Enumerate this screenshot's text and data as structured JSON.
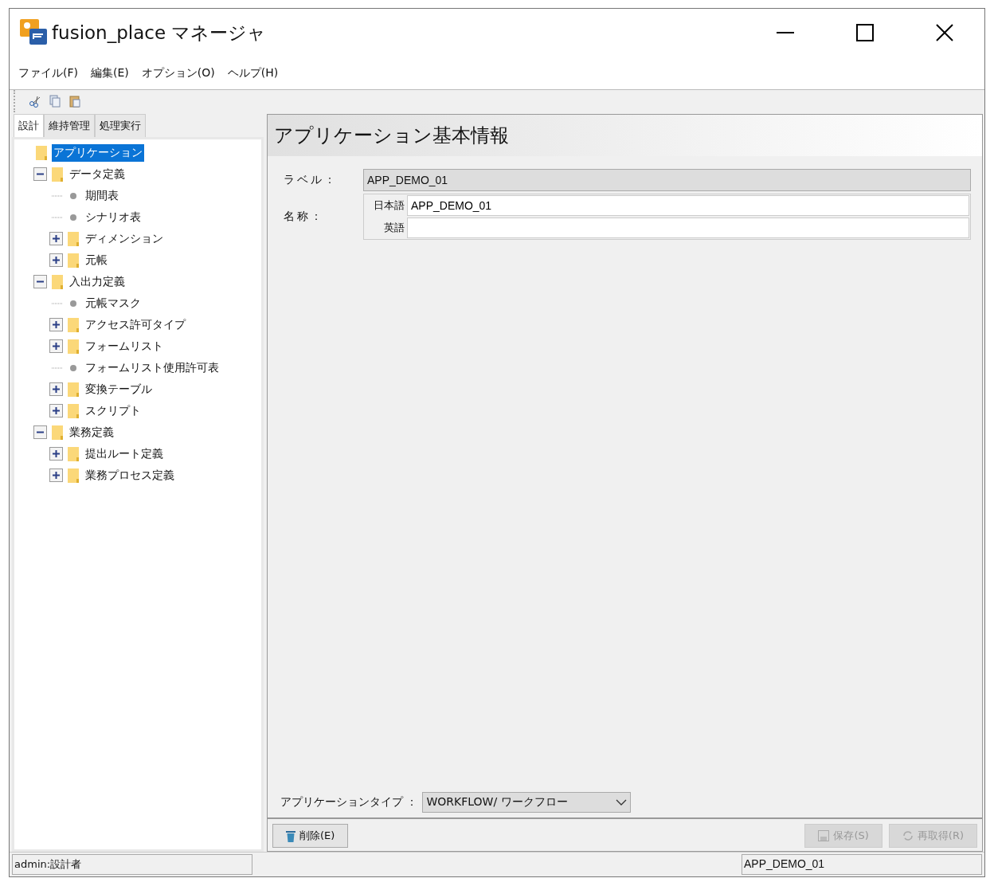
{
  "window": {
    "title": "fusion_place マネージャ"
  },
  "menu": [
    "ファイル(F)",
    "編集(E)",
    "オプション(O)",
    "ヘルプ(H)"
  ],
  "left_tabs": [
    {
      "label": "設計",
      "selected": true
    },
    {
      "label": "維持管理",
      "selected": false
    },
    {
      "label": "処理実行",
      "selected": false
    }
  ],
  "tree": [
    {
      "label": "アプリケーション",
      "kind": "folder",
      "selected": true,
      "children": [
        {
          "label": "データ定義",
          "kind": "folder",
          "expanded": true,
          "selected": false,
          "children": [
            {
              "label": "期間表",
              "kind": "leaf",
              "selected": false
            },
            {
              "label": "シナリオ表",
              "kind": "leaf",
              "selected": false
            },
            {
              "label": "ディメンション",
              "kind": "folder",
              "expanded": false,
              "selected": false
            },
            {
              "label": "元帳",
              "kind": "folder",
              "expanded": false,
              "selected": false
            }
          ]
        },
        {
          "label": "入出力定義",
          "kind": "folder",
          "expanded": true,
          "selected": false,
          "children": [
            {
              "label": "元帳マスク",
              "kind": "leaf",
              "selected": false
            },
            {
              "label": "アクセス許可タイプ",
              "kind": "folder",
              "expanded": false,
              "selected": false
            },
            {
              "label": "フォームリスト",
              "kind": "folder",
              "expanded": false,
              "selected": false
            },
            {
              "label": "フォームリスト使用許可表",
              "kind": "leaf",
              "selected": false
            },
            {
              "label": "変換テーブル",
              "kind": "folder",
              "expanded": false,
              "selected": false
            },
            {
              "label": "スクリプト",
              "kind": "folder",
              "expanded": false,
              "selected": false
            }
          ]
        },
        {
          "label": "業務定義",
          "kind": "folder",
          "expanded": true,
          "selected": false,
          "children": [
            {
              "label": "提出ルート定義",
              "kind": "folder",
              "expanded": false,
              "selected": false
            },
            {
              "label": "業務プロセス定義",
              "kind": "folder",
              "expanded": false,
              "selected": false
            }
          ]
        }
      ]
    }
  ],
  "panel": {
    "title": "アプリケーション基本情報",
    "label_field": {
      "label": "ラベル：",
      "value": "APP_DEMO_01"
    },
    "name_field": {
      "label": "名称：",
      "rows": [
        {
          "lang": "日本語",
          "value": "APP_DEMO_01"
        },
        {
          "lang": "英語",
          "value": ""
        }
      ]
    },
    "app_type": {
      "label": "アプリケーションタイプ ：",
      "value": "WORKFLOW/ ワークフロー"
    },
    "buttons": [
      {
        "label": "削除(E)",
        "kind": "delete",
        "disabled": false
      },
      {
        "label": "保存(S)",
        "kind": "save",
        "disabled": true
      },
      {
        "label": "再取得(R)",
        "kind": "reload",
        "disabled": true
      }
    ]
  },
  "status_bar": {
    "user": "admin:設計者",
    "app": "APP_DEMO_01"
  }
}
